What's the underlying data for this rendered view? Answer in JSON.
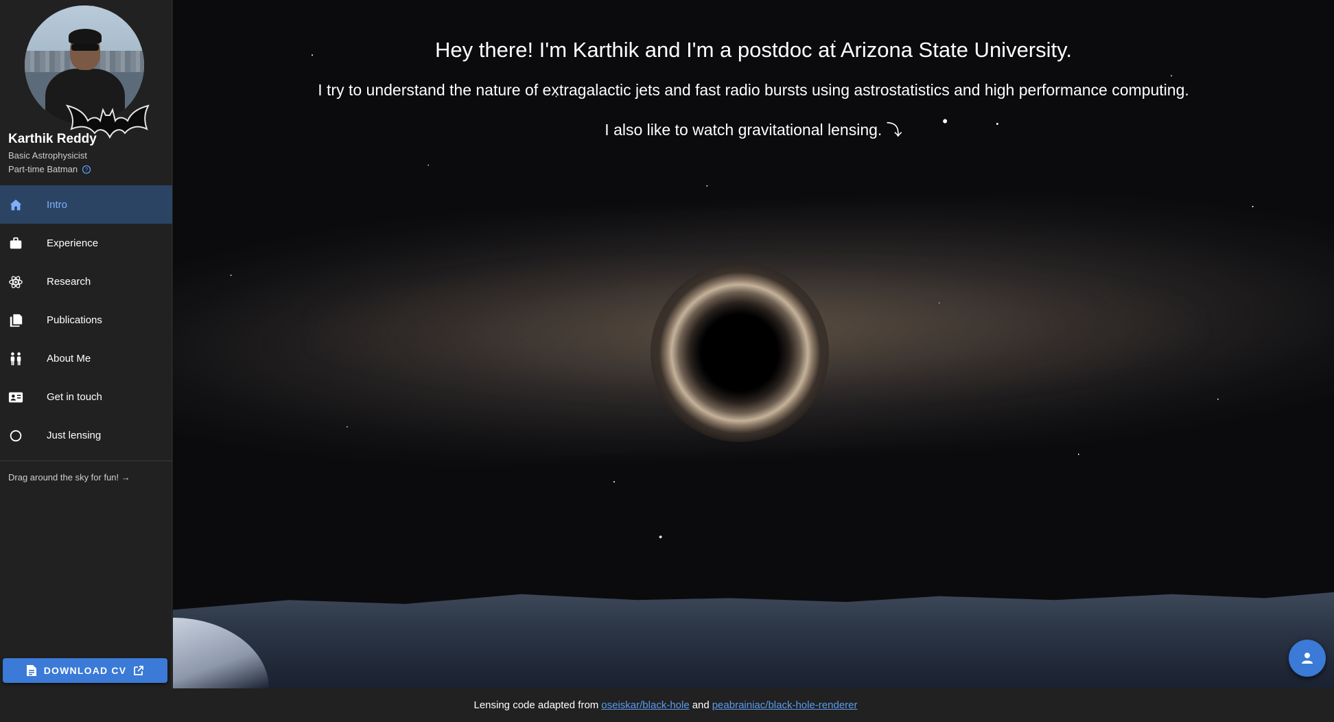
{
  "profile": {
    "name": "Karthik Reddy",
    "role": "Basic Astrophysicist",
    "role2": "Part-time Batman"
  },
  "nav": {
    "items": [
      {
        "label": "Intro",
        "icon": "home-icon",
        "active": true
      },
      {
        "label": "Experience",
        "icon": "briefcase-icon",
        "active": false
      },
      {
        "label": "Research",
        "icon": "atom-icon",
        "active": false
      },
      {
        "label": "Publications",
        "icon": "documents-icon",
        "active": false
      },
      {
        "label": "About Me",
        "icon": "people-icon",
        "active": false
      },
      {
        "label": "Get in touch",
        "icon": "contact-card-icon",
        "active": false
      },
      {
        "label": "Just lensing",
        "icon": "circle-icon",
        "active": false
      }
    ]
  },
  "drag_hint": "Drag around the sky for fun! →",
  "cv_button": {
    "label": "DOWNLOAD CV"
  },
  "hero": {
    "heading": "Hey there! I'm Karthik and I'm a postdoc at Arizona State University.",
    "line1": "I try to understand the nature of extragalactic jets and fast radio bursts using astrostatistics and high performance computing.",
    "line2": "I also like to watch gravitational lensing. ⤵"
  },
  "footer": {
    "prefix": "Lensing code adapted from",
    "link1": "oseiskar/black-hole",
    "middle": "and",
    "link2": "peabrainiac/black-hole-renderer"
  },
  "colors": {
    "accent": "#3b7ad6",
    "active_nav_bg": "#2c4464",
    "active_nav_text": "#7fb0ff",
    "link": "#5a9cf0"
  }
}
